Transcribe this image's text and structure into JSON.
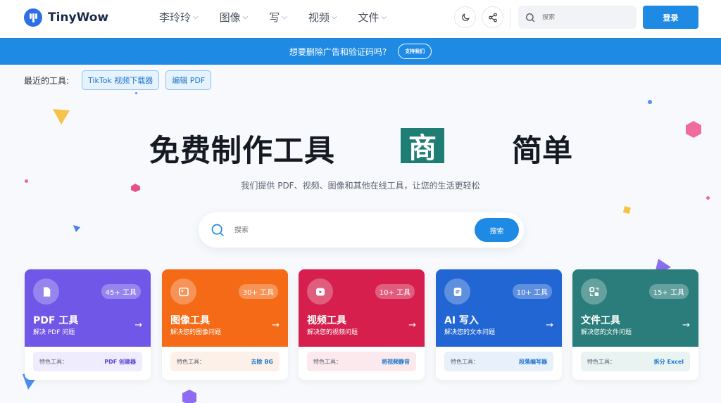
{
  "header": {
    "logo_text": "TinyWow",
    "nav": [
      {
        "label": "李玲玲"
      },
      {
        "label": "图像"
      },
      {
        "label": "写"
      },
      {
        "label": "视频"
      },
      {
        "label": "文件"
      }
    ],
    "search_placeholder": "搜索",
    "login_label": "登录"
  },
  "banner": {
    "text": "想要删除广告和验证码吗?",
    "button_label": "支持我们"
  },
  "recent": {
    "label": "最近的工具:",
    "chips": [
      "TikTok 视频下载器",
      "编辑 PDF"
    ]
  },
  "hero": {
    "title_part1": "免费制作工具",
    "title_highlight": "商",
    "title_part2": "简单",
    "subtitle": "我们提供 PDF、视频、图像和其他在线工具，让您的生活更轻松",
    "search_placeholder": "搜索",
    "search_button": "搜索"
  },
  "cards": [
    {
      "title": "PDF 工具",
      "desc": "解决 PDF 问题",
      "badge": "45+ 工具",
      "foot_label": "特色工具：",
      "foot_link": "PDF 创建器",
      "color": "#7057e8",
      "foot_bg": "#efedfd",
      "link_color": "#5b46d6"
    },
    {
      "title": "图像工具",
      "desc": "解决您的图像问题",
      "badge": "30+ 工具",
      "foot_label": "特色工具：",
      "foot_link": "去除 BG",
      "color": "#f46a16",
      "foot_bg": "#fdf0e8",
      "link_color": "#1f77c9"
    },
    {
      "title": "视频工具",
      "desc": "解决您的视频问题",
      "badge": "10+ 工具",
      "foot_label": "特色工具：",
      "foot_link": "将视频静音",
      "color": "#d61f4c",
      "foot_bg": "#fbe9ee",
      "link_color": "#1f77c9"
    },
    {
      "title": "AI 写入",
      "desc": "解决您的文本问题",
      "badge": "10+ 工具",
      "foot_label": "特色工具：",
      "foot_link": "段落编写器",
      "color": "#2266d4",
      "foot_bg": "#e8f0fc",
      "link_color": "#1f77c9"
    },
    {
      "title": "文件工具",
      "desc": "解决您的文件问题",
      "badge": "15+ 工具",
      "foot_label": "特色工具：",
      "foot_link": "拆分 Excel",
      "color": "#2a7d7a",
      "foot_bg": "#e8f3f2",
      "link_color": "#1f77c9"
    }
  ],
  "colors": {
    "primary": "#1f8ae4",
    "highlight": "#1e7d75"
  }
}
